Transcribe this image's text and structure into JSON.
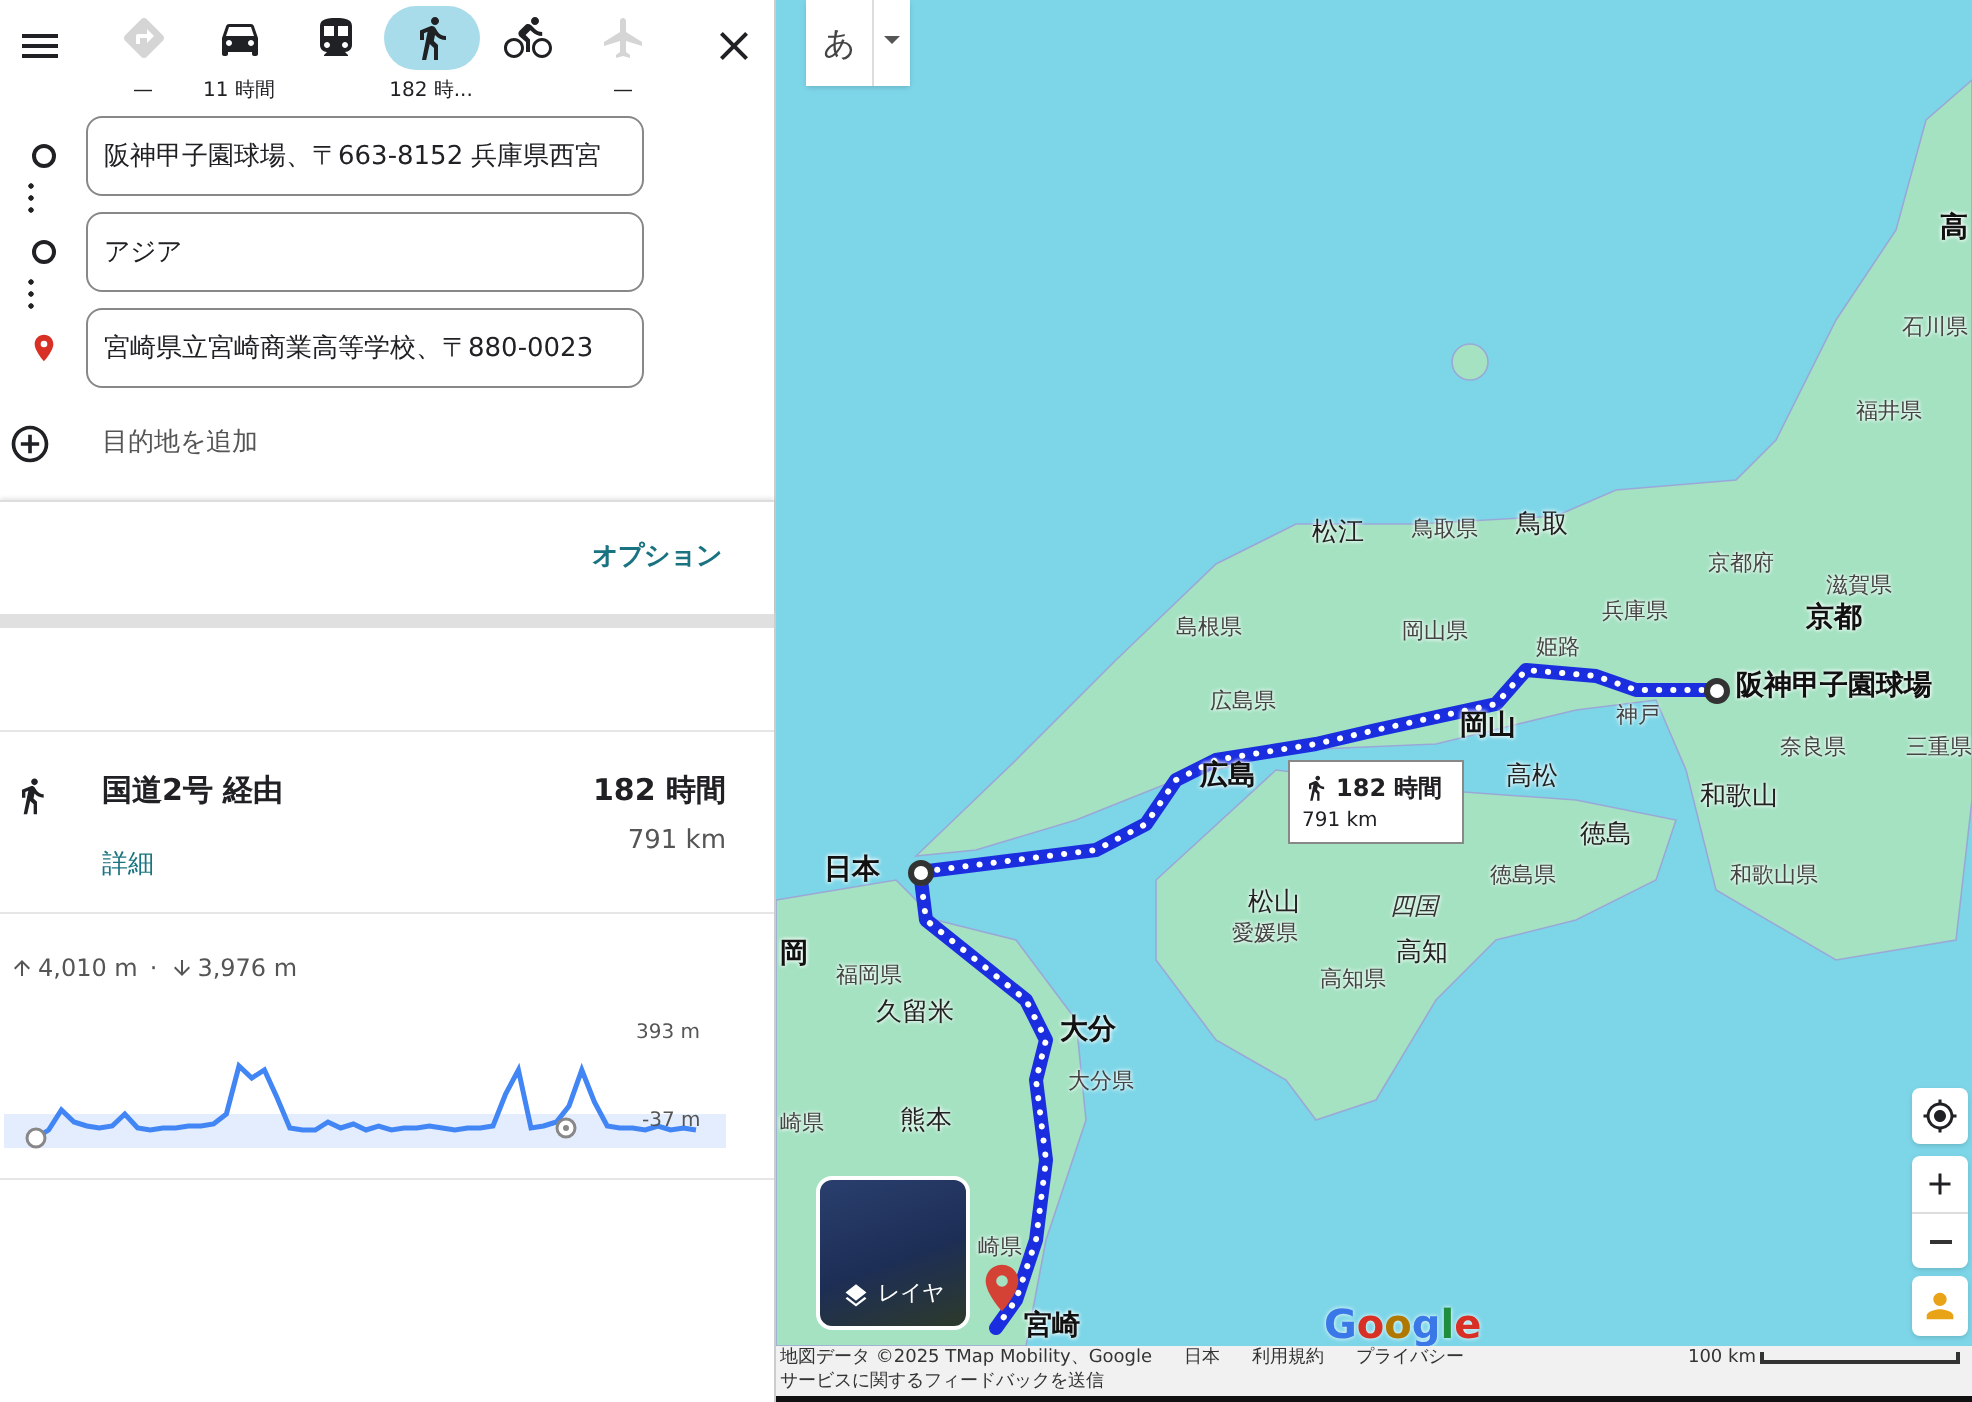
{
  "top_bar": {
    "modes": [
      {
        "kind": "directions",
        "time": "—",
        "selected": false,
        "disabled": true
      },
      {
        "kind": "car",
        "time": "11 時間",
        "selected": false,
        "disabled": false
      },
      {
        "kind": "transit",
        "selected": false,
        "disabled": false
      },
      {
        "kind": "walk",
        "time": "182 時...",
        "selected": true,
        "disabled": false
      },
      {
        "kind": "bike",
        "selected": false,
        "disabled": false
      },
      {
        "kind": "flight",
        "time": "—",
        "selected": false,
        "disabled": true
      }
    ]
  },
  "waypoints": [
    {
      "kind": "origin",
      "value": "阪神甲子園球場、〒663-8152 兵庫県西宮"
    },
    {
      "kind": "stop",
      "value": "アジア"
    },
    {
      "kind": "destination",
      "value": "宮崎県立宮崎商業高等学校、〒880-0023"
    }
  ],
  "add_destination": "目的地を追加",
  "options_link": "オプション",
  "route": {
    "name": "国道2号 経由",
    "duration": "182 時間",
    "distance": "791 km",
    "details_link": "詳細"
  },
  "elevation": {
    "ascent": "4,010 m",
    "separator": "·",
    "descent": "3,976 m",
    "max_label": "393 m",
    "min_label": "-37 m"
  },
  "map": {
    "input_mode": "あ",
    "labels": [
      {
        "text": "高",
        "kind": "major"
      },
      {
        "text": "石川県",
        "kind": "pref"
      },
      {
        "text": "福井県",
        "kind": "pref"
      },
      {
        "text": "松江",
        "kind": "city"
      },
      {
        "text": "鳥取県",
        "kind": "pref"
      },
      {
        "text": "鳥取",
        "kind": "city"
      },
      {
        "text": "京都府",
        "kind": "pref"
      },
      {
        "text": "滋賀県",
        "kind": "pref"
      },
      {
        "text": "島根県",
        "kind": "pref"
      },
      {
        "text": "岡山県",
        "kind": "pref"
      },
      {
        "text": "兵庫県",
        "kind": "pref"
      },
      {
        "text": "京都",
        "kind": "major"
      },
      {
        "text": "姫路",
        "kind": "pref"
      },
      {
        "text": "広島県",
        "kind": "pref"
      },
      {
        "text": "岡山",
        "kind": "major"
      },
      {
        "text": "神戸",
        "kind": "pref"
      },
      {
        "text": "阪神甲子園球場",
        "kind": "major"
      },
      {
        "text": "奈良県",
        "kind": "pref"
      },
      {
        "text": "三重県",
        "kind": "pref"
      },
      {
        "text": "広島",
        "kind": "major"
      },
      {
        "text": "高松",
        "kind": "city"
      },
      {
        "text": "和歌山",
        "kind": "city"
      },
      {
        "text": "徳島",
        "kind": "city"
      },
      {
        "text": "日本",
        "kind": "major"
      },
      {
        "text": "徳島県",
        "kind": "pref"
      },
      {
        "text": "和歌山県",
        "kind": "pref"
      },
      {
        "text": "松山",
        "kind": "city"
      },
      {
        "text": "四国",
        "kind": "island"
      },
      {
        "text": "愛媛県",
        "kind": "pref"
      },
      {
        "text": "岡",
        "kind": "major"
      },
      {
        "text": "高知",
        "kind": "city"
      },
      {
        "text": "福岡県",
        "kind": "pref"
      },
      {
        "text": "高知県",
        "kind": "pref"
      },
      {
        "text": "久留米",
        "kind": "city"
      },
      {
        "text": "大分",
        "kind": "major"
      },
      {
        "text": "大分県",
        "kind": "pref"
      },
      {
        "text": "崎県",
        "kind": "pref"
      },
      {
        "text": "熊本",
        "kind": "city"
      },
      {
        "text": "崎県",
        "kind": "pref"
      },
      {
        "text": "宮崎",
        "kind": "major"
      }
    ],
    "callout": {
      "duration": "182 時間",
      "distance": "791 km"
    },
    "layers_button": "レイヤ",
    "logo": "Google",
    "footer": {
      "attribution": "地図データ ©2025 TMap Mobility、Google",
      "region": "日本",
      "terms": "利用規約",
      "privacy": "プライバシー",
      "scale": "100 km",
      "feedback": "サービスに関するフィードバックを送信"
    }
  }
}
